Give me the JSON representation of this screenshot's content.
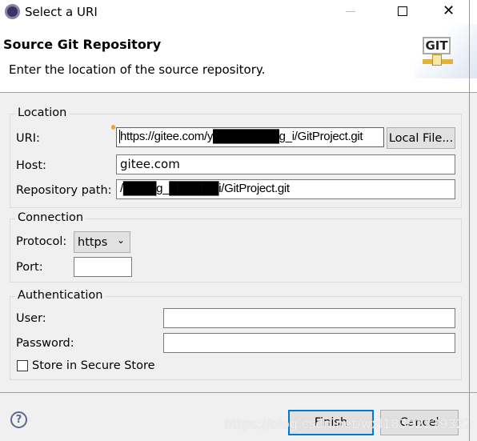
{
  "window": {
    "title": "Select a URI"
  },
  "header": {
    "title": "Source Git Repository",
    "description": "Enter the location of the source repository.",
    "logo_text": "GIT"
  },
  "location": {
    "legend": "Location",
    "uri_label": "URI:",
    "uri_value": "https://gitee.com/y████████g_i/GitProject.git",
    "local_file_label": "Local File...",
    "host_label": "Host:",
    "host_value": "gitee.com",
    "repo_label": "Repository path:",
    "repo_value": "/████g_██████i/GitProject.git"
  },
  "connection": {
    "legend": "Connection",
    "protocol_label": "Protocol:",
    "protocol_value": "https",
    "port_label": "Port:",
    "port_value": ""
  },
  "authentication": {
    "legend": "Authentication",
    "user_label": "User:",
    "user_value": "",
    "password_label": "Password:",
    "password_value": "",
    "secure_store_label": "Store in Secure Store",
    "secure_store_checked": false
  },
  "footer": {
    "finish_label": "Finish",
    "cancel_label": "Cancel",
    "watermark": "https://blog.csdn.net/wxl18392239322"
  },
  "colors": {
    "focus": "#0078d7",
    "background": "#f0f0f0"
  }
}
